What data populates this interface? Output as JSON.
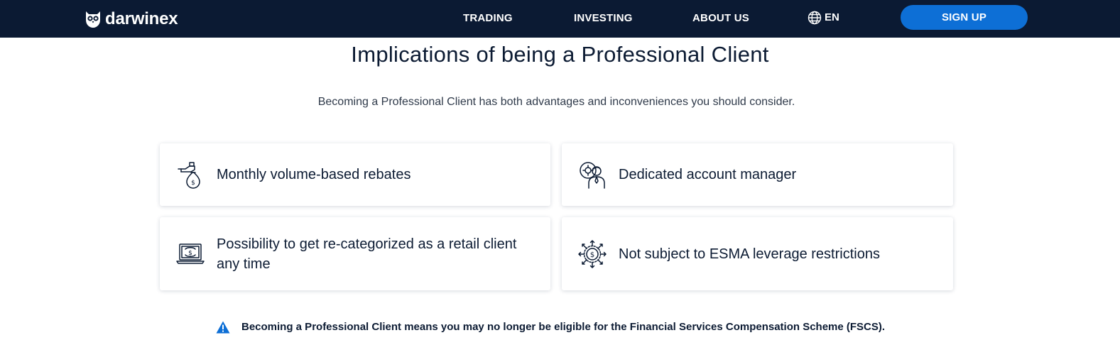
{
  "header": {
    "brand": "darwinex",
    "nav": {
      "trading": "TRADING",
      "investing": "INVESTING",
      "about": "ABOUT US"
    },
    "language": "EN",
    "signup_label": "SIGN UP",
    "colors": {
      "bar": "#0b1a33",
      "button": "#0d6fd6"
    }
  },
  "main": {
    "title": "Implications of being a Professional Client",
    "subtitle": "Becoming a Professional Client has both advantages and inconveniences you should consider.",
    "features": [
      {
        "icon": "money-bag-hand-icon",
        "text": "Monthly volume-based rebates"
      },
      {
        "icon": "account-manager-icon",
        "text": "Dedicated account manager"
      },
      {
        "icon": "laptop-dollar-icon",
        "text": "Possibility to get re-categorized as a retail client any time"
      },
      {
        "icon": "dollar-arrows-icon",
        "text": "Not subject to ESMA leverage restrictions"
      }
    ],
    "notice": {
      "icon": "warning-icon",
      "text": "Becoming a Professional Client means you may no longer be eligible for the Financial Services Compensation Scheme (FSCS)."
    }
  }
}
